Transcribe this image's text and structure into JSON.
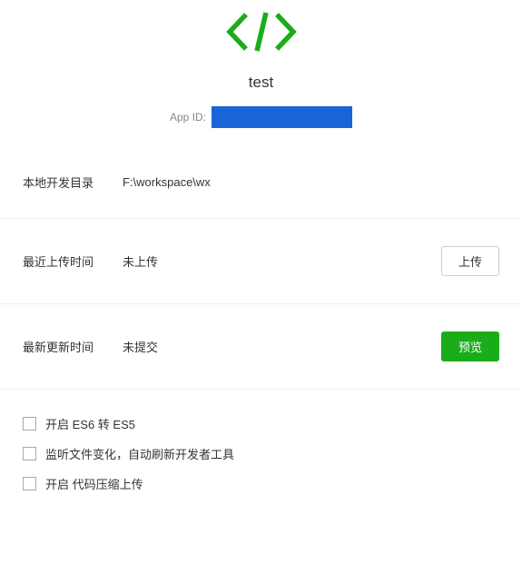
{
  "header": {
    "project_name": "test",
    "appid_label": "App ID:"
  },
  "sections": {
    "dev_dir": {
      "label": "本地开发目录",
      "value": "F:\\workspace\\wx"
    },
    "last_upload": {
      "label": "最近上传时间",
      "value": "未上传",
      "button": "上传"
    },
    "last_update": {
      "label": "最新更新时间",
      "value": "未提交",
      "button": "预览"
    }
  },
  "options": {
    "es6": "开启 ES6 转 ES5",
    "watch": "监听文件变化，自动刷新开发者工具",
    "minify": "开启 代码压缩上传"
  },
  "colors": {
    "accent_green": "#1aad19",
    "appid_mask": "#1865d8"
  }
}
